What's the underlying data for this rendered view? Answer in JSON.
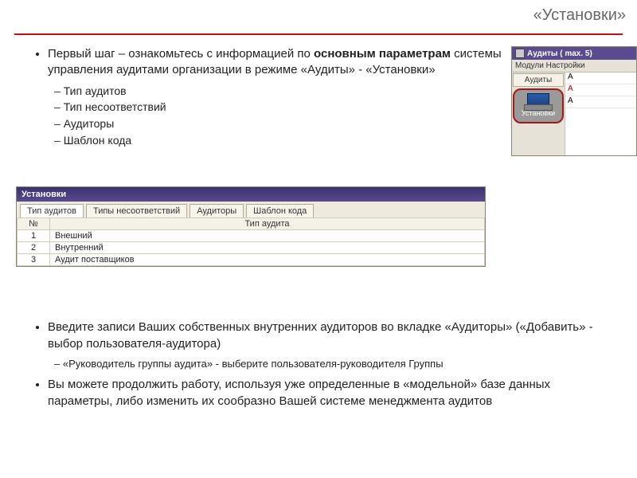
{
  "title": "«Установки»",
  "top": {
    "p1_a": "Первый шаг – ознакомьтесь с информацией по ",
    "p1_b": "основным параметрам",
    "p1_c": " системы управления аудитами организации в режиме «Аудиты» - «Установки»",
    "sub": [
      "Тип аудитов",
      "Тип несоответствий",
      "Аудиторы",
      "Шаблон кода"
    ]
  },
  "miniwin": {
    "title": "Аудиты ( max. 5)",
    "menu": "Модули  Настройки",
    "btn1": "Аудиты",
    "btn2": "Установки",
    "rows": [
      "А",
      "А",
      "А"
    ]
  },
  "appwin": {
    "title": "Установки",
    "tabs": [
      "Тип аудитов",
      "Типы несоответствий",
      "Аудиторы",
      "Шаблон кода"
    ],
    "col_num": "№",
    "col_name": "Тип аудита",
    "rows": [
      {
        "n": "1",
        "v": "Внешний"
      },
      {
        "n": "2",
        "v": "Внутренний"
      },
      {
        "n": "3",
        "v": "Аудит поставщиков"
      }
    ]
  },
  "bottom": {
    "b1": "Введите записи Ваших собственных внутренних аудиторов во вкладке «Аудиторы» («Добавить» - выбор пользователя-аудитора)",
    "b1s": "«Руководитель группы аудита» - выберите пользователя-руководителя Группы",
    "b2": "Вы можете продолжить работу, используя уже определенные в «модельной» базе данных  параметры, либо изменить их сообразно Вашей системе менеджмента аудитов"
  }
}
